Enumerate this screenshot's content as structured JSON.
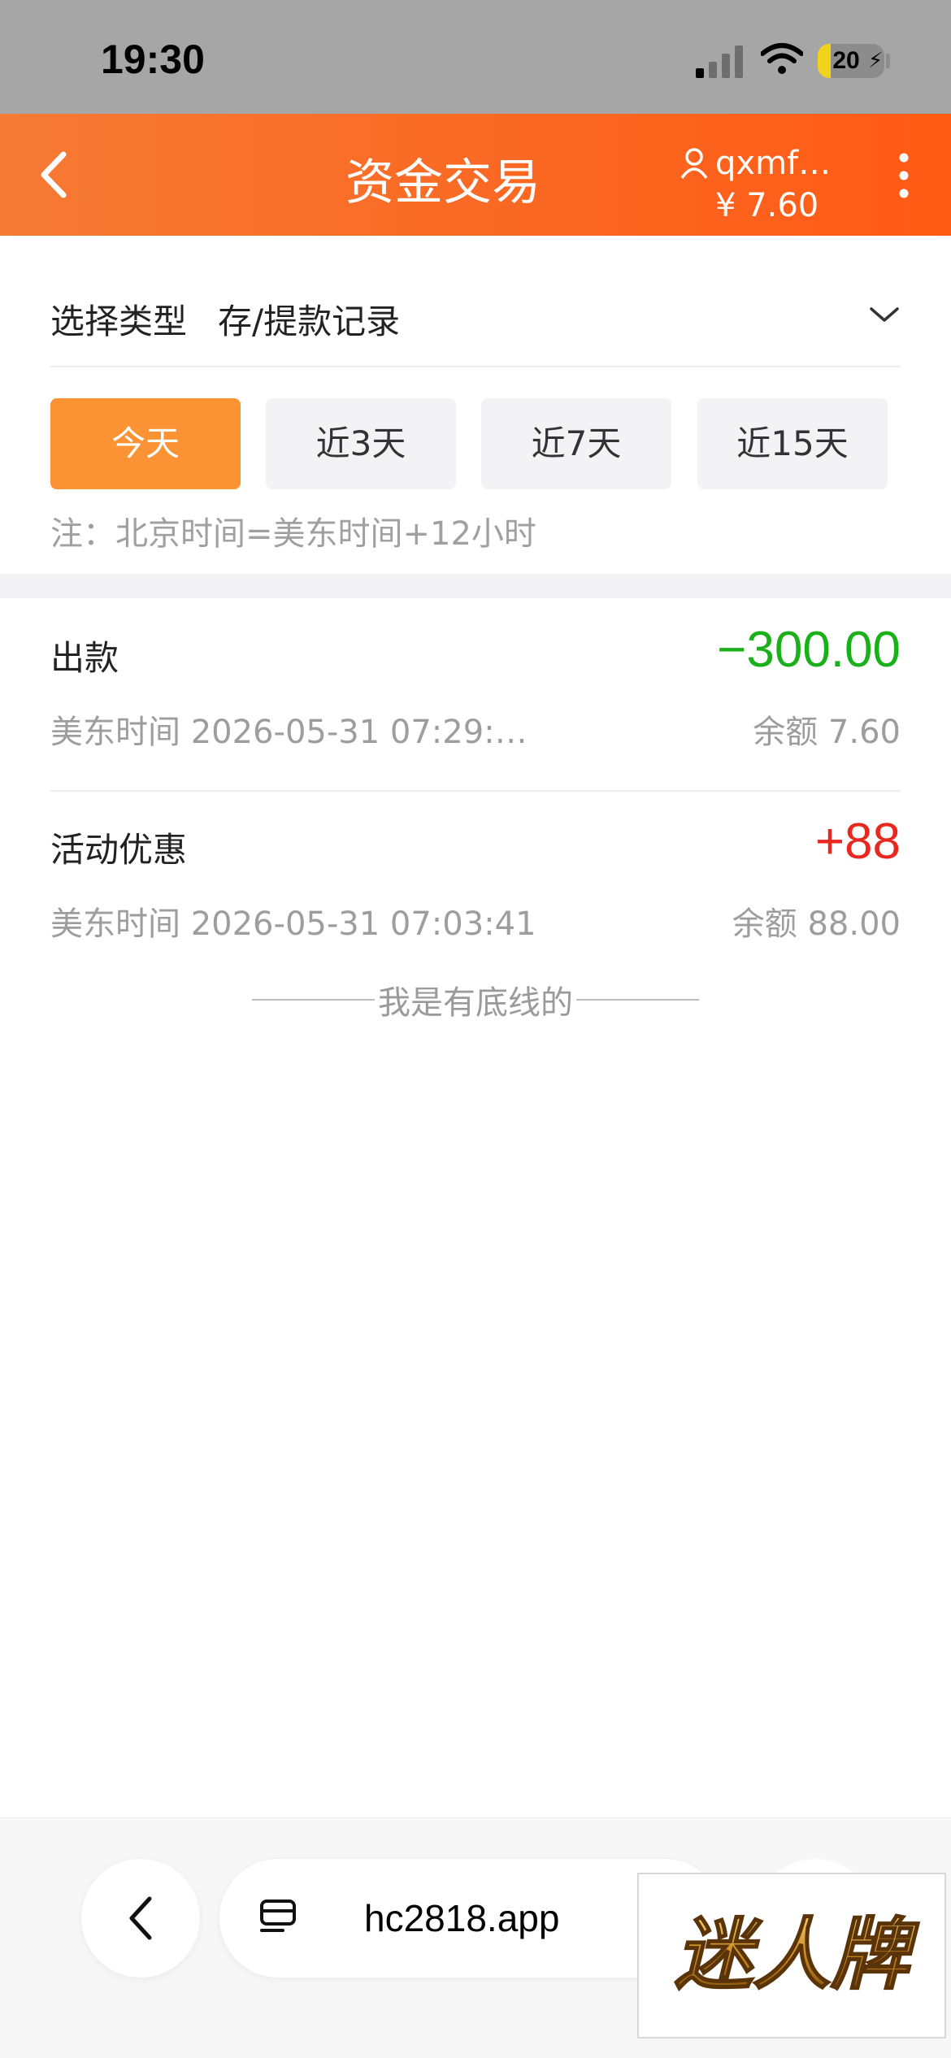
{
  "status_bar": {
    "time": "19:30",
    "battery_level": "20",
    "battery_fraction": 0.2,
    "icons": [
      "signal-icon",
      "wifi-icon",
      "battery-icon"
    ]
  },
  "header": {
    "title": "资金交易",
    "username": "qxmf…",
    "balance": "¥ 7.60",
    "icons": [
      "back-arrow-icon",
      "user-icon",
      "more-vertical-icon"
    ],
    "gradient_colors": [
      "#f57a34",
      "#ff5a14"
    ]
  },
  "filter": {
    "type_label": "选择类型",
    "type_value": "存/提款记录",
    "periods": [
      {
        "label": "今天",
        "active": true
      },
      {
        "label": "近3天",
        "active": false
      },
      {
        "label": "近7天",
        "active": false
      },
      {
        "label": "近15天",
        "active": false
      }
    ],
    "note": "注：北京时间=美东时间+12小时",
    "active_color": "#fb9233"
  },
  "records": [
    {
      "type": "出款",
      "amount": "−300.00",
      "time": "美东时间 2026-05-31 07:29:…",
      "balance": "余额 7.60",
      "amount_color": "#19b019"
    },
    {
      "type": "活动优惠",
      "amount": "+88",
      "time": "美东时间 2026-05-31 07:03:41",
      "balance": "余额 88.00",
      "amount_color": "#e8281e"
    }
  ],
  "end_text": "我是有底线的",
  "browser": {
    "url": "hc2818.app",
    "icons": [
      "back-chevron-icon",
      "reader-mode-icon"
    ]
  },
  "watermark": {
    "text": "迷人牌"
  }
}
